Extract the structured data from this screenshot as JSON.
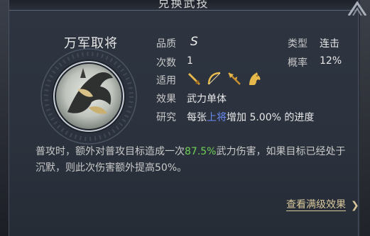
{
  "window": {
    "title": "兑换武技"
  },
  "skill": {
    "name": "万军取将",
    "quality_label": "品质",
    "quality_value": "S",
    "count_label": "次数",
    "count_value": "1",
    "type_label": "类型",
    "type_value": "连击",
    "rate_label": "概率",
    "rate_value": "12%",
    "applies_label": "适用",
    "applies_icons": [
      "sword-icon",
      "bow-icon",
      "spear-icon",
      "horse-icon"
    ],
    "effect_label": "效果",
    "effect_value": "武力单体",
    "research_label": "研究",
    "research_prefix": "每张",
    "research_highlight": "上将",
    "research_suffix": "增加 5.00% 的进度"
  },
  "description": {
    "part1": "普攻时，额外对普攻目标造成一次",
    "highlight": "87.5%",
    "part2": "武力伤害，如果目标已经处于沉默，则此次伤害额外提高50%。"
  },
  "footer": {
    "link_label": "查看满级效果",
    "chevron": "❯"
  },
  "colors": {
    "highlight_green": "#6fcf56",
    "highlight_blue": "#6b8cf7",
    "link_gold": "#d8c79b"
  }
}
